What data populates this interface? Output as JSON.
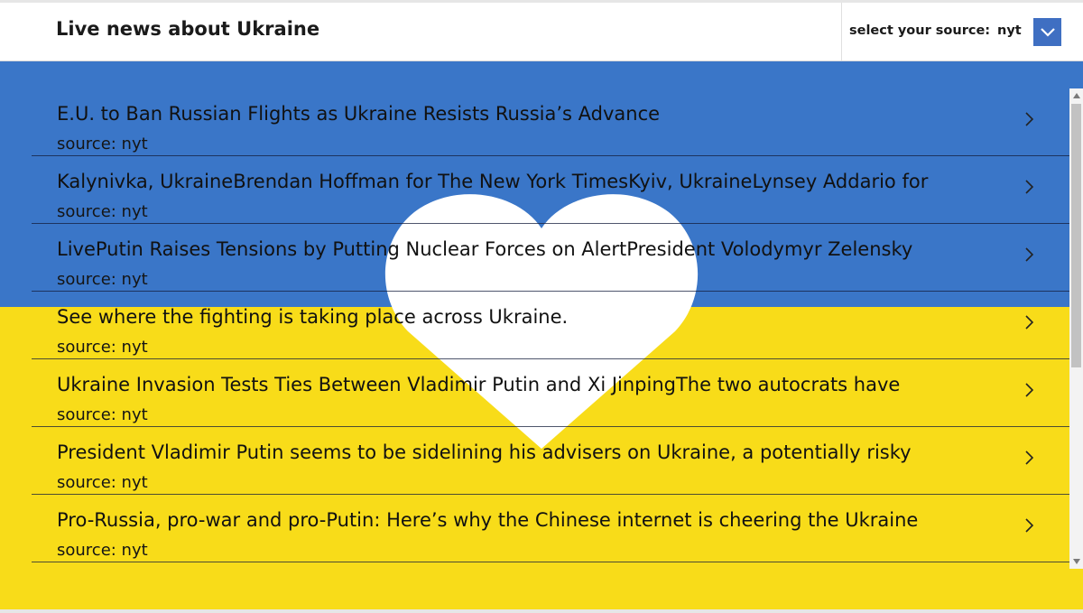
{
  "header": {
    "title": "Live news about Ukraine",
    "source_label": "select your source:",
    "source_value": "nyt",
    "dropdown_icon": "chevron-down-icon"
  },
  "colors": {
    "flag_blue": "#3a76c8",
    "flag_yellow": "#f8dc19",
    "dropdown_bg": "#3f6fc2",
    "heart": "#ffffff"
  },
  "news": {
    "items": [
      {
        "title": "E.U. to Ban Russian Flights as Ukraine Resists Russia’s Advance",
        "source": "source: nyt"
      },
      {
        "title": "Kalynivka, UkraineBrendan Hoffman for The New York TimesKyiv, UkraineLynsey Addario for",
        "source": "source: nyt"
      },
      {
        "title": "LivePutin Raises Tensions by Putting Nuclear Forces on AlertPresident Volodymyr Zelensky",
        "source": "source: nyt"
      },
      {
        "title": "See where the fighting is taking place across Ukraine.",
        "source": "source: nyt"
      },
      {
        "title": "Ukraine Invasion Tests Ties Between Vladimir Putin and Xi JinpingThe two autocrats have",
        "source": "source: nyt"
      },
      {
        "title": "President Vladimir Putin seems to be sidelining his advisers on Ukraine, a potentially risky",
        "source": "source: nyt"
      },
      {
        "title": "Pro-Russia, pro-war and pro-Putin: Here’s why the Chinese internet is cheering the Ukraine",
        "source": "source: nyt"
      }
    ],
    "item_icon": "chevron-right-icon"
  }
}
